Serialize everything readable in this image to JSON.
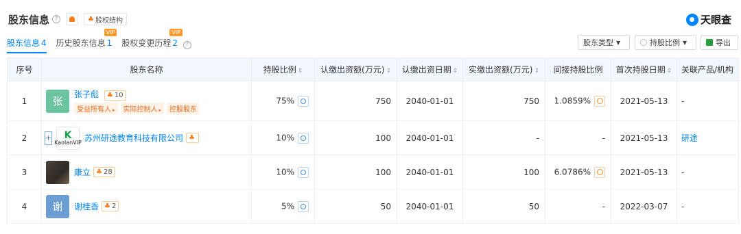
{
  "header": {
    "title": "股东信息",
    "equity_button": "股权结构",
    "brand": "天眼查"
  },
  "tabs": [
    {
      "label": "股东信息",
      "count": "4"
    },
    {
      "label": "历史股东信息",
      "count": "1",
      "badge": "VIP"
    },
    {
      "label": "股权变更历程",
      "count": "2",
      "badge": "VIP"
    }
  ],
  "toolbar": {
    "type_filter": "股东类型",
    "ratio_filter": "持股比例",
    "export": "导出"
  },
  "columns": [
    "序号",
    "股东名称",
    "持股比例",
    "认缴出资额(万元)",
    "认缴出资日期",
    "实缴出资额(万元)",
    "间接持股比例",
    "首次持股日期",
    "关联产品/机构"
  ],
  "rows": [
    {
      "no": "1",
      "avatar_text": "张",
      "name": "张子彪",
      "holdings": "10",
      "tags": [
        "受益所有人",
        "实际控制人",
        "控股股东"
      ],
      "ratio": "75%",
      "subscribed": "750",
      "sub_date": "2040-01-01",
      "paid": "750",
      "indirect": "1.0859%",
      "first_date": "2021-05-13",
      "related": "-"
    },
    {
      "no": "2",
      "avatar_text": "K",
      "avatar_sub": "KaolanVIP",
      "name": "苏州研途教育科技有限公司",
      "holdings": "",
      "tags": [],
      "ratio": "10%",
      "subscribed": "100",
      "sub_date": "2040-01-01",
      "paid": "-",
      "indirect": "-",
      "first_date": "2021-05-13",
      "related": "研途"
    },
    {
      "no": "3",
      "avatar_text": "",
      "name": "康立",
      "holdings": "28",
      "tags": [],
      "ratio": "10%",
      "subscribed": "100",
      "sub_date": "2040-01-01",
      "paid": "100",
      "indirect": "6.0786%",
      "first_date": "2021-05-13",
      "related": "-"
    },
    {
      "no": "4",
      "avatar_text": "谢",
      "name": "谢桂香",
      "holdings": "2",
      "tags": [],
      "ratio": "5%",
      "subscribed": "50",
      "sub_date": "2040-01-01",
      "paid": "50",
      "indirect": "-",
      "first_date": "2022-03-07",
      "related": "-"
    }
  ],
  "colors": {
    "accent": "#0084ff",
    "orange": "#ff7a1a",
    "header_bg": "#f2f7fe"
  }
}
